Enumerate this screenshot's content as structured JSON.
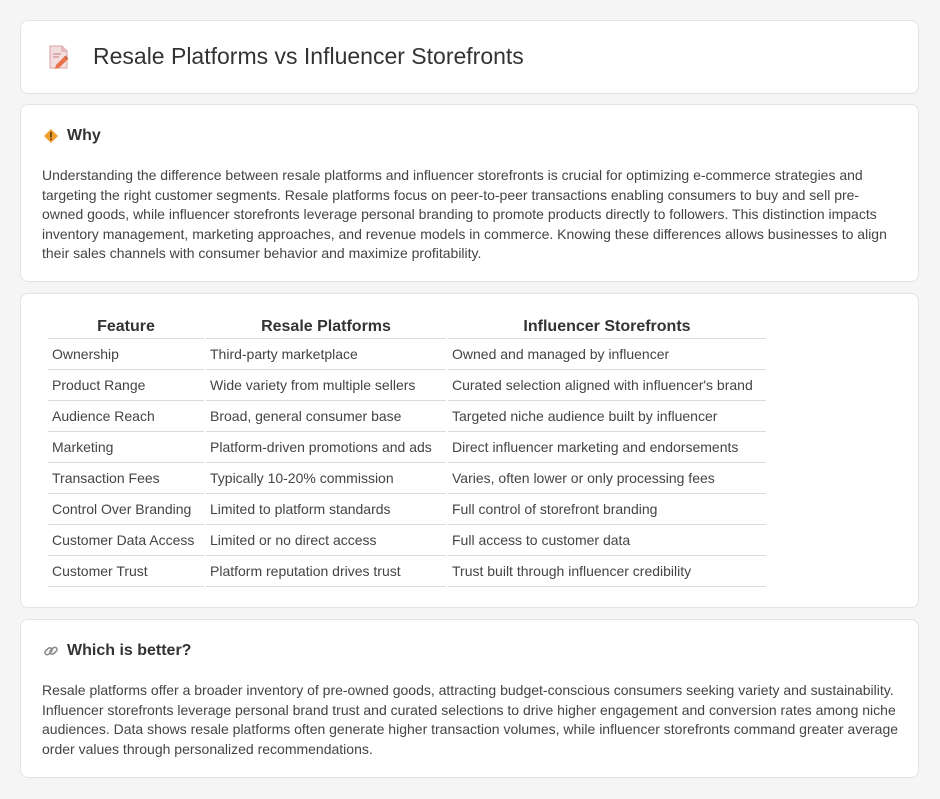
{
  "header": {
    "title": "Resale Platforms vs Influencer Storefronts",
    "icon": "document-pencil-icon"
  },
  "why": {
    "icon": "warning-diamond-icon",
    "title": "Why",
    "text": "Understanding the difference between resale platforms and influencer storefronts is crucial for optimizing e-commerce strategies and targeting the right customer segments. Resale platforms focus on peer-to-peer transactions enabling consumers to buy and sell pre-owned goods, while influencer storefronts leverage personal branding to promote products directly to followers. This distinction impacts inventory management, marketing approaches, and revenue models in commerce. Knowing these differences allows businesses to align their sales channels with consumer behavior and maximize profitability."
  },
  "table": {
    "headers": [
      "Feature",
      "Resale Platforms",
      "Influencer Storefronts"
    ],
    "rows": [
      [
        "Ownership",
        "Third-party marketplace",
        "Owned and managed by influencer"
      ],
      [
        "Product Range",
        "Wide variety from multiple sellers",
        "Curated selection aligned with influencer's brand"
      ],
      [
        "Audience Reach",
        "Broad, general consumer base",
        "Targeted niche audience built by influencer"
      ],
      [
        "Marketing",
        "Platform-driven promotions and ads",
        "Direct influencer marketing and endorsements"
      ],
      [
        "Transaction Fees",
        "Typically 10-20% commission",
        "Varies, often lower or only processing fees"
      ],
      [
        "Control Over Branding",
        "Limited to platform standards",
        "Full control of storefront branding"
      ],
      [
        "Customer Data Access",
        "Limited or no direct access",
        "Full access to customer data"
      ],
      [
        "Customer Trust",
        "Platform reputation drives trust",
        "Trust built through influencer credibility"
      ]
    ]
  },
  "better": {
    "icon": "link-icon",
    "title": "Which is better?",
    "text": "Resale platforms offer a broader inventory of pre-owned goods, attracting budget-conscious consumers seeking variety and sustainability. Influencer storefronts leverage personal brand trust and curated selections to drive higher engagement and conversion rates among niche audiences. Data shows resale platforms often generate higher transaction volumes, while influencer storefronts command greater average order values through personalized recommendations."
  },
  "colors": {
    "background": "#f5f5f5",
    "card": "#ffffff",
    "icon_accent": "#e8734a",
    "warning_accent": "#f0a030"
  }
}
